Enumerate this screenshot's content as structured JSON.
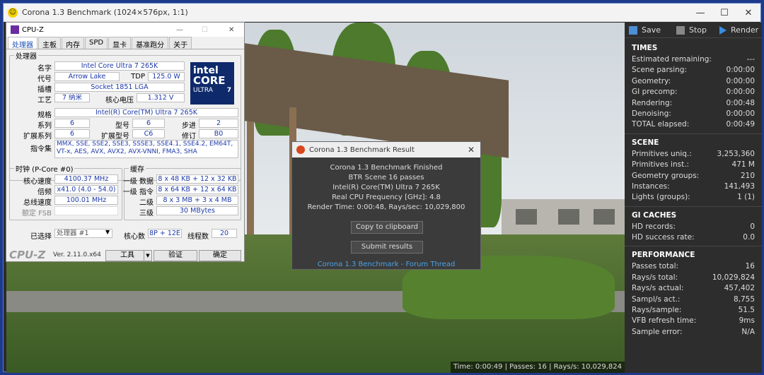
{
  "main_window": {
    "title": "Corona 1.3 Benchmark (1024×576px, 1:1)"
  },
  "toolbar": {
    "save": "Save",
    "stop": "Stop",
    "render": "Render"
  },
  "times": {
    "heading": "TIMES",
    "rows": [
      {
        "label": "Estimated remaining:",
        "value": "---"
      },
      {
        "label": "Scene parsing:",
        "value": "0:00:00"
      },
      {
        "label": "Geometry:",
        "value": "0:00:00"
      },
      {
        "label": "GI precomp:",
        "value": "0:00:00"
      },
      {
        "label": "Rendering:",
        "value": "0:00:48"
      },
      {
        "label": "Denoising:",
        "value": "0:00:00"
      },
      {
        "label": "TOTAL elapsed:",
        "value": "0:00:49"
      }
    ]
  },
  "scene": {
    "heading": "SCENE",
    "rows": [
      {
        "label": "Primitives uniq.:",
        "value": "3,253,360"
      },
      {
        "label": "Primitives inst.:",
        "value": "471 M"
      },
      {
        "label": "Geometry groups:",
        "value": "210"
      },
      {
        "label": "Instances:",
        "value": "141,493"
      },
      {
        "label": "Lights (groups):",
        "value": "1 (1)"
      }
    ]
  },
  "gi_caches": {
    "heading": "GI CACHES",
    "rows": [
      {
        "label": "HD records:",
        "value": "0"
      },
      {
        "label": "HD success rate:",
        "value": "0.0"
      }
    ]
  },
  "performance": {
    "heading": "PERFORMANCE",
    "rows": [
      {
        "label": "Passes total:",
        "value": "16"
      },
      {
        "label": "Rays/s total:",
        "value": "10,029,824"
      },
      {
        "label": "Rays/s actual:",
        "value": "457,402"
      },
      {
        "label": "Sampl/s act.:",
        "value": "8,755"
      },
      {
        "label": "Rays/sample:",
        "value": "51.5"
      },
      {
        "label": "VFB refresh time:",
        "value": "9ms"
      },
      {
        "label": "Sample error:",
        "value": "N/A"
      }
    ]
  },
  "status_bar": "Time: 0:00:49 | Passes: 16 | Rays/s: 10,029,824",
  "result_dialog": {
    "title": "Corona 1.3 Benchmark Result",
    "lines": [
      "Corona 1.3 Benchmark Finished",
      "BTR Scene 16 passes",
      "Intel(R) Core(TM) Ultra 7 265K",
      "Real CPU Frequency [GHz]: 4.8",
      "Render Time: 0:00:48, Rays/sec: 10,029,800"
    ],
    "copy_button": "Copy to clipboard",
    "submit_button": "Submit results",
    "link": "Corona 1.3 Benchmark - Forum Thread"
  },
  "cpuz": {
    "title": "CPU-Z",
    "tabs": [
      "处理器",
      "主板",
      "内存",
      "SPD",
      "显卡",
      "基准跑分",
      "关于"
    ],
    "processor_group": "处理器",
    "name_label": "名字",
    "name": "Intel Core Ultra 7 265K",
    "codename_label": "代号",
    "codename": "Arrow Lake",
    "tdp_label": "TDP",
    "tdp": "125.0 W",
    "socket_label": "插槽",
    "socket": "Socket 1851 LGA",
    "process_label": "工艺",
    "process": "7 纳米",
    "voltage_label": "核心电压",
    "voltage": "1.312 V",
    "spec_label": "规格",
    "spec": "Intel(R) Core(TM) Ultra 7 265K",
    "family_label": "系列",
    "family": "6",
    "model_label": "型号",
    "model": "6",
    "stepping_label": "步进",
    "stepping": "2",
    "extfamily_label": "扩展系列",
    "extfamily": "6",
    "extmodel_label": "扩展型号",
    "extmodel": "C6",
    "revision_label": "修订",
    "revision": "B0",
    "instr_label": "指令集",
    "instructions": "MMX, SSE, SSE2, SSE3, SSSE3, SSE4.1, SSE4.2, EM64T, VT-x, AES, AVX, AVX2, AVX-VNNI, FMA3, SHA",
    "intel_brand": "intel",
    "intel_core": "CORE",
    "intel_ultra": "ULTRA",
    "intel_7": "7",
    "clock_group": "时钟 (P-Core #0)",
    "core_speed_label": "核心速度",
    "core_speed": "4100.37 MHz",
    "multiplier_label": "倍频",
    "multiplier": "x41.0 (4.0 - 54.0)",
    "bus_speed_label": "总线速度",
    "bus_speed": "100.01 MHz",
    "rated_fsb_label": "额定 FSB",
    "rated_fsb": "",
    "cache_group": "缓存",
    "l1d_label": "一级 数据",
    "l1d": "8 x 48 KB + 12 x 32 KB",
    "l1i_label": "一级 指令",
    "l1i": "8 x 64 KB + 12 x 64 KB",
    "l2_label": "二级",
    "l2": "8 x 3 MB + 3 x 4 MB",
    "l3_label": "三级",
    "l3": "30 MBytes",
    "selected_label": "已选择",
    "selected": "处理器 #1",
    "cores_label": "核心数",
    "cores": "8P + 12E",
    "threads_label": "线程数",
    "threads": "20",
    "brand": "CPU-Z",
    "version": "Ver. 2.11.0.x64",
    "tools_button": "工具",
    "validate_button": "验证",
    "ok_button": "确定"
  }
}
